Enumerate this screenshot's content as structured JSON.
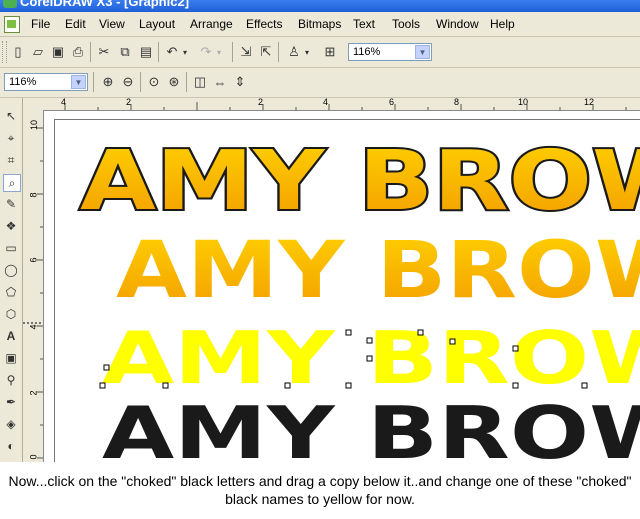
{
  "window": {
    "title": "CorelDRAW X3 - [Graphic2]"
  },
  "menu": [
    "File",
    "Edit",
    "View",
    "Layout",
    "Arrange",
    "Effects",
    "Bitmaps",
    "Text",
    "Tools",
    "Window",
    "Help"
  ],
  "standard_toolbar": {
    "zoom_value": "116%"
  },
  "zoom_toolbar": {
    "zoom_value": "116%"
  },
  "rulers": {
    "horizontal": [
      "4",
      "2",
      "2",
      "4",
      "6",
      "8",
      "10",
      "12"
    ],
    "vertical": [
      "10",
      "8",
      "6",
      "4",
      "2",
      "0"
    ]
  },
  "artwork": {
    "line1": "AMY BROW",
    "line2": "AMY BROW",
    "line3": "AMY BROW",
    "line4": "AMY BROW",
    "colors": {
      "orange_top": "#ffd200",
      "orange_bottom": "#f39c00",
      "yellow": "#ffff00",
      "black": "#1a1a1a"
    }
  },
  "instruction": "Now...click on the \"choked\" black letters and drag a copy below it..and change one of these \"choked\" black names to yellow for now."
}
